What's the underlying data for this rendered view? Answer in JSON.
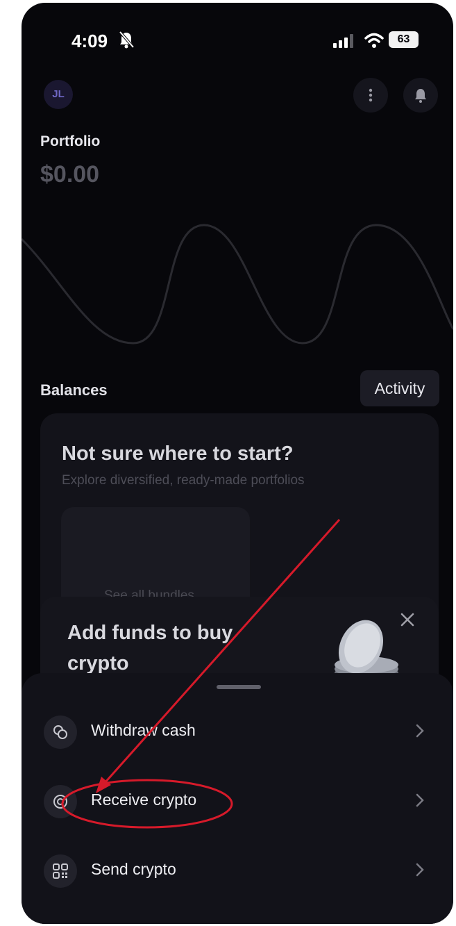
{
  "status_bar": {
    "time": "4:09",
    "battery": "63",
    "icons": [
      "bell-off-icon",
      "signal-icon",
      "wifi-icon",
      "battery-icon"
    ]
  },
  "header": {
    "avatar_initials": "JL",
    "icons": [
      "more-vertical-icon",
      "bell-icon"
    ]
  },
  "portfolio": {
    "label": "Portfolio",
    "value": "$0.00"
  },
  "balances": {
    "label": "Balances",
    "activity_button": "Activity"
  },
  "start_card": {
    "title": "Not sure where to start?",
    "subtitle": "Explore diversified, ready-made portfolios",
    "bundle_link": "See all bundles"
  },
  "funds_card": {
    "title": "Add funds to buy crypto",
    "icons": [
      "close-icon",
      "coins-illustration"
    ]
  },
  "sheet": {
    "items": [
      {
        "label": "Withdraw cash",
        "icon": "coins-icon"
      },
      {
        "label": "Receive crypto",
        "icon": "receive-icon"
      },
      {
        "label": "Send crypto",
        "icon": "qr-code-icon"
      }
    ]
  },
  "colors": {
    "background": "#07070b",
    "sheet": "#121219",
    "annotation": "#d61a2a",
    "avatar_accent": "#7068c7"
  }
}
